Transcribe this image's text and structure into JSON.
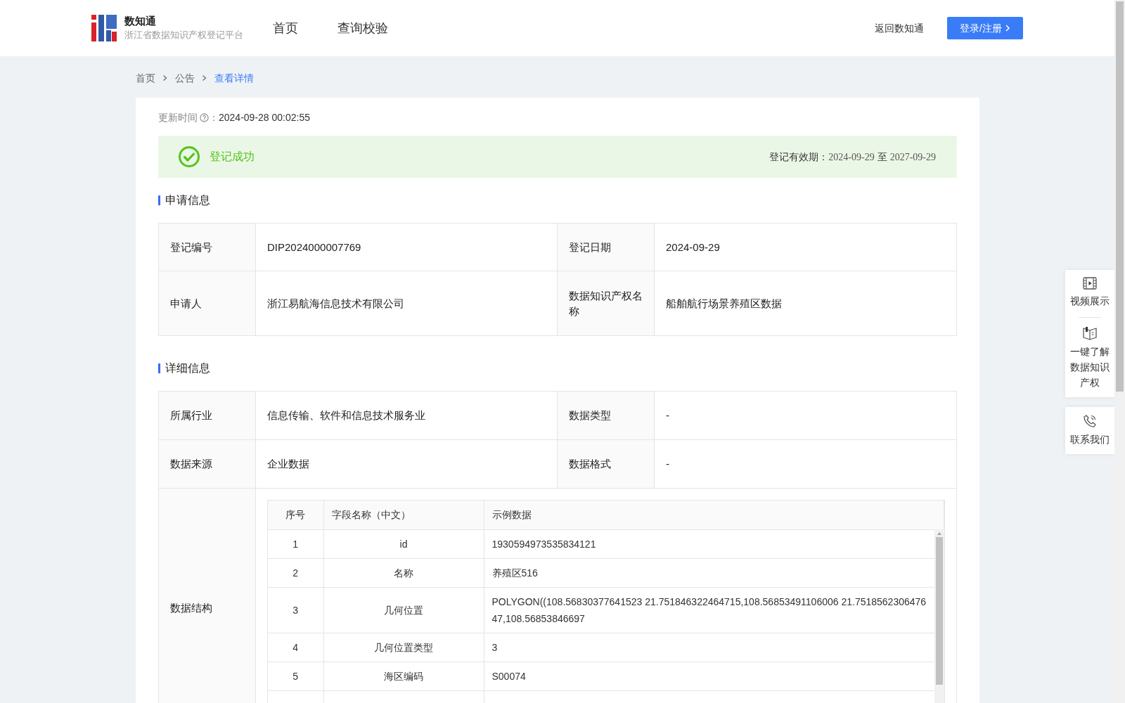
{
  "header": {
    "brand": "数知通",
    "subtitle": "浙江省数据知识产权登记平台",
    "nav": [
      {
        "label": "首页",
        "selected": false
      },
      {
        "label": "查询校验",
        "selected": false
      }
    ],
    "back_link": "返回数知通",
    "login_button": "登录/注册"
  },
  "breadcrumb": [
    {
      "label": "首页",
      "current": false
    },
    {
      "label": "公告",
      "current": false
    },
    {
      "label": "查看详情",
      "current": true
    }
  ],
  "update_time": {
    "label": "更新时间",
    "colon": "：",
    "value": "2024-09-28 00:02:55"
  },
  "status": {
    "text": "登记成功",
    "validity_label": "登记有效期：",
    "validity_from": "2024-09-29",
    "validity_sep": "至",
    "validity_to": "2027-09-29"
  },
  "application_section": {
    "title": "申请信息",
    "rows": [
      {
        "cells": [
          "登记编号",
          "DIP2024000007769",
          "登记日期",
          "2024-09-29"
        ]
      },
      {
        "cells": [
          "申请人",
          "浙江易航海信息技术有限公司",
          "数据知识产权名称",
          "船舶航行场景养殖区数据"
        ]
      }
    ]
  },
  "detail_section": {
    "title": "详细信息",
    "rows": [
      {
        "cells": [
          "所属行业",
          "信息传输、软件和信息技术服务业",
          "数据类型",
          "-"
        ]
      },
      {
        "cells": [
          "数据来源",
          "企业数据",
          "数据格式",
          "-"
        ]
      }
    ],
    "structure_label": "数据结构",
    "structure_table": {
      "columns": [
        "序号",
        "字段名称（中文）",
        "示例数据"
      ],
      "rows": [
        [
          "1",
          "id",
          "1930594973535834121"
        ],
        [
          "2",
          "名称",
          "养殖区516"
        ],
        [
          "3",
          "几何位置",
          "POLYGON((108.56830377641523 21.751846322464715,108.56853491106006 21.751856230647647,108.56853846697"
        ],
        [
          "4",
          "几何位置类型",
          "3"
        ],
        [
          "5",
          "海区编码",
          "S00074"
        ]
      ]
    }
  },
  "side_panel": [
    {
      "kind": "video",
      "label": "视频展示"
    },
    {
      "kind": "book",
      "label": "一键了解数据知识产权"
    },
    {
      "kind": "phone",
      "label": "联系我们"
    }
  ]
}
